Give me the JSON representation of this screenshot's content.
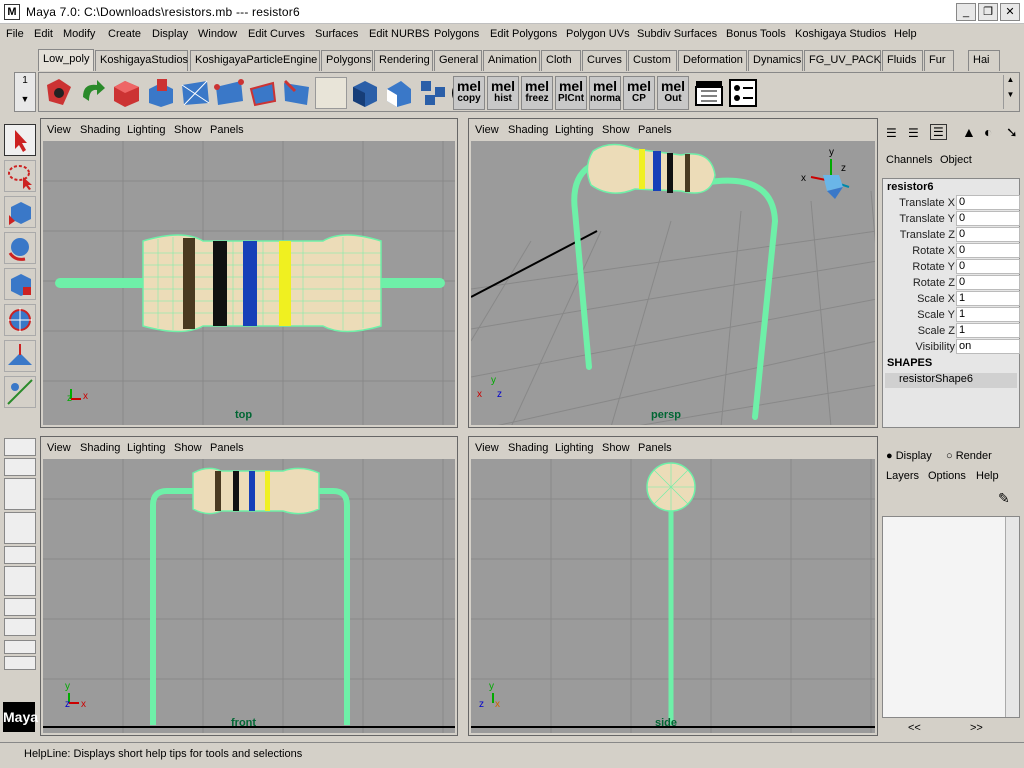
{
  "window": {
    "title": "Maya 7.0: C:\\Downloads\\resistors.mb   ---   resistor6",
    "icon_letter": "M"
  },
  "window_controls": {
    "minimize": "_",
    "maximize": "❐",
    "close": "✕"
  },
  "menu": [
    "File",
    "Edit",
    "Modify",
    "Create",
    "Display",
    "Window",
    "Edit Curves",
    "Surfaces",
    "Edit NURBS",
    "Polygons",
    "Edit Polygons",
    "Polygon UVs",
    "Subdiv Surfaces",
    "Bonus Tools",
    "Koshigaya Studios",
    "Help"
  ],
  "shelf_tabs": [
    "Low_poly",
    "KoshigayaStudios",
    "KoshigayaParticleEngine",
    "Polygons",
    "Rendering",
    "General",
    "Animation",
    "Cloth",
    "Curves",
    "Custom",
    "Deformation",
    "Dynamics",
    "FG_UV_PACK",
    "Fluids",
    "Fur",
    "Hai"
  ],
  "shelf_active_tab": "Low_poly",
  "shelf_left_value": "1",
  "mel_buttons": [
    {
      "top": "mel",
      "label": "copy"
    },
    {
      "top": "mel",
      "label": "hist"
    },
    {
      "top": "mel",
      "label": "freez"
    },
    {
      "top": "mel",
      "label": "PICnt"
    },
    {
      "top": "mel",
      "label": "norma"
    },
    {
      "top": "mel",
      "label": "CP"
    },
    {
      "top": "mel",
      "label": "Out"
    }
  ],
  "viewport_menu": [
    "View",
    "Shading",
    "Lighting",
    "Show",
    "Panels"
  ],
  "viewports": {
    "top": {
      "label": "top"
    },
    "persp": {
      "label": "persp"
    },
    "front": {
      "label": "front"
    },
    "side": {
      "label": "side"
    }
  },
  "axis": {
    "x": "x",
    "y": "y",
    "z": "z"
  },
  "channel_box": {
    "tabs": [
      "Channels",
      "Object"
    ],
    "object_name": "resistor6",
    "attributes": [
      {
        "name": "Translate X",
        "value": "0"
      },
      {
        "name": "Translate Y",
        "value": "0"
      },
      {
        "name": "Translate Z",
        "value": "0"
      },
      {
        "name": "Rotate X",
        "value": "0"
      },
      {
        "name": "Rotate Y",
        "value": "0"
      },
      {
        "name": "Rotate Z",
        "value": "0"
      },
      {
        "name": "Scale X",
        "value": "1"
      },
      {
        "name": "Scale Y",
        "value": "1"
      },
      {
        "name": "Scale Z",
        "value": "1"
      },
      {
        "name": "Visibility",
        "value": "on"
      }
    ],
    "shapes_header": "SHAPES",
    "shape_name": "resistorShape6"
  },
  "layer_panel": {
    "display_label": "Display",
    "render_label": "Render",
    "menu": [
      "Layers",
      "Options",
      "Help"
    ],
    "scroll_left": "<<",
    "scroll_right": ">>"
  },
  "logo_text": "Maya",
  "helpline": "HelpLine: Displays short help tips for tools and selections",
  "colors": {
    "wire": "#6ef0a8",
    "viewport_bg": "#9b9b9b",
    "body": "#ecdcb8"
  }
}
